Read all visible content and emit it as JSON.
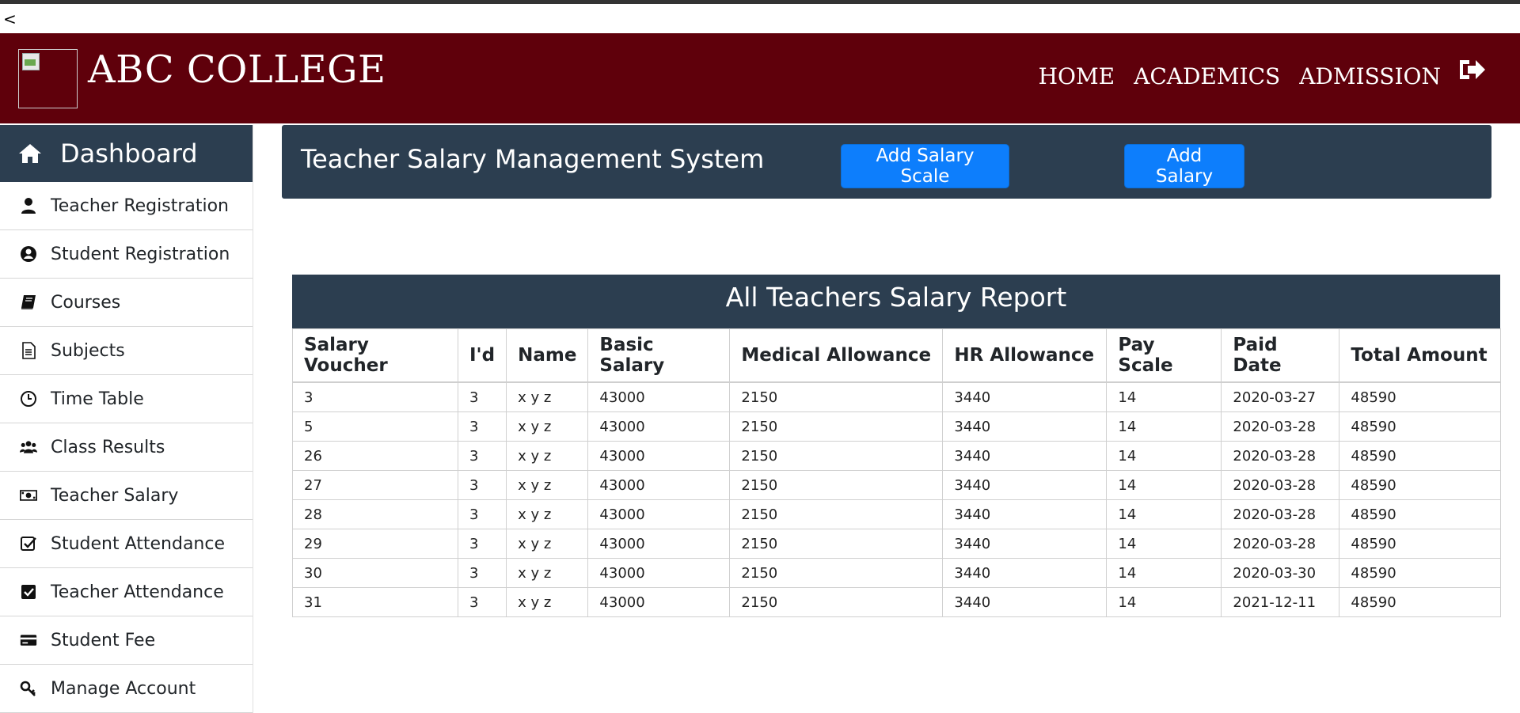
{
  "back_link": "<",
  "header": {
    "brand": "ABC COLLEGE",
    "nav": [
      "HOME",
      "ACADEMICS",
      "ADMISSION"
    ],
    "logout_icon": "sign-out-icon",
    "bg_color": "#5f000b"
  },
  "sidebar": {
    "dashboard": "Dashboard",
    "items": [
      {
        "label": "Teacher Registration",
        "icon": "user-icon"
      },
      {
        "label": "Student Registration",
        "icon": "user-circle-icon"
      },
      {
        "label": "Courses",
        "icon": "book-icon"
      },
      {
        "label": "Subjects",
        "icon": "file-icon"
      },
      {
        "label": "Time Table",
        "icon": "clock-icon"
      },
      {
        "label": "Class Results",
        "icon": "users-icon"
      },
      {
        "label": "Teacher Salary",
        "icon": "money-bill-icon"
      },
      {
        "label": "Student Attendance",
        "icon": "check-square-outline-icon"
      },
      {
        "label": "Teacher Attendance",
        "icon": "check-square-icon"
      },
      {
        "label": "Student Fee",
        "icon": "credit-card-icon"
      },
      {
        "label": "Manage Account",
        "icon": "key-icon"
      }
    ]
  },
  "banner": {
    "title": "Teacher Salary Management System",
    "add_scale_label": "Add Salary Scale",
    "add_salary_label": "Add Salary"
  },
  "report": {
    "title": "All Teachers Salary Report",
    "columns": [
      "Salary Voucher",
      "I'd",
      "Name",
      "Basic Salary",
      "Medical Allowance",
      "HR Allowance",
      "Pay Scale",
      "Paid Date",
      "Total Amount"
    ],
    "rows": [
      [
        "3",
        "3",
        "x y z",
        "43000",
        "2150",
        "3440",
        "14",
        "2020-03-27",
        "48590"
      ],
      [
        "5",
        "3",
        "x y z",
        "43000",
        "2150",
        "3440",
        "14",
        "2020-03-28",
        "48590"
      ],
      [
        "26",
        "3",
        "x y z",
        "43000",
        "2150",
        "3440",
        "14",
        "2020-03-28",
        "48590"
      ],
      [
        "27",
        "3",
        "x y z",
        "43000",
        "2150",
        "3440",
        "14",
        "2020-03-28",
        "48590"
      ],
      [
        "28",
        "3",
        "x y z",
        "43000",
        "2150",
        "3440",
        "14",
        "2020-03-28",
        "48590"
      ],
      [
        "29",
        "3",
        "x y z",
        "43000",
        "2150",
        "3440",
        "14",
        "2020-03-28",
        "48590"
      ],
      [
        "30",
        "3",
        "x y z",
        "43000",
        "2150",
        "3440",
        "14",
        "2020-03-30",
        "48590"
      ],
      [
        "31",
        "3",
        "x y z",
        "43000",
        "2150",
        "3440",
        "14",
        "2021-12-11",
        "48590"
      ]
    ]
  },
  "colors": {
    "header": "#5f000b",
    "panel": "#2c3e50",
    "button": "#0d7efc"
  }
}
